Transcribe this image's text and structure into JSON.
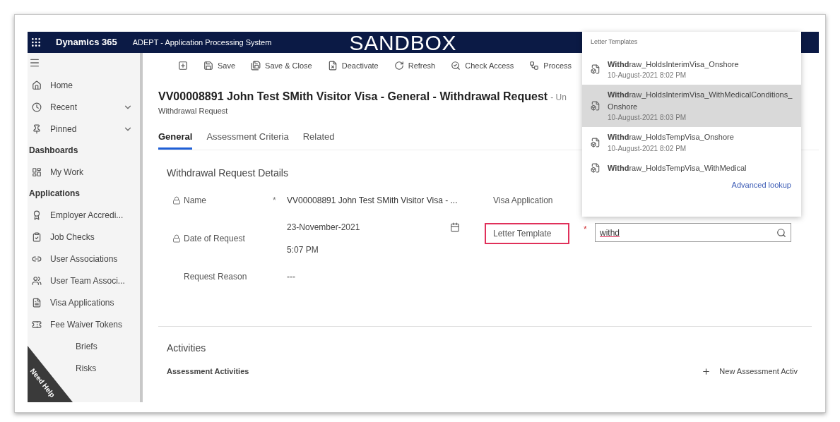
{
  "top_bar": {
    "app_name": "Dynamics 365",
    "system_name": "ADEPT - Application Processing System",
    "environment": "SANDBOX"
  },
  "sidebar": {
    "items": [
      {
        "label": "Home",
        "kind": "home"
      },
      {
        "label": "Recent",
        "kind": "recent"
      },
      {
        "label": "Pinned",
        "kind": "pinned"
      }
    ],
    "sections": [
      {
        "title": "Dashboards",
        "items": [
          {
            "label": "My Work",
            "kind": "dashboard"
          }
        ]
      },
      {
        "title": "Applications",
        "items": [
          {
            "label": "Employer Accredi...",
            "kind": "certificate"
          },
          {
            "label": "Job Checks",
            "kind": "check"
          },
          {
            "label": "User Associations",
            "kind": "link"
          },
          {
            "label": "User Team Associ...",
            "kind": "team"
          },
          {
            "label": "Visa Applications",
            "kind": "document"
          },
          {
            "label": "Fee Waiver Tokens",
            "kind": "token"
          },
          {
            "label": "Briefs",
            "kind": "obscured"
          },
          {
            "label": "Risks",
            "kind": "obscured"
          }
        ]
      }
    ],
    "help_badge": "Need Help"
  },
  "toolbar": [
    {
      "kind": "new"
    },
    {
      "kind": "save",
      "label": "Save"
    },
    {
      "kind": "save_close",
      "label": "Save & Close"
    },
    {
      "kind": "deactivate",
      "label": "Deactivate"
    },
    {
      "kind": "refresh",
      "label": "Refresh"
    },
    {
      "kind": "access",
      "label": "Check Access"
    },
    {
      "kind": "process",
      "label": "Process"
    }
  ],
  "header": {
    "title": "VV00008891 John Test SMith Visitor Visa - General - Withdrawal Request",
    "title_suffix": "- Un",
    "subtitle": "Withdrawal Request"
  },
  "tabs": [
    {
      "label": "General",
      "selected": true
    },
    {
      "label": "Assessment Criteria",
      "selected": false
    },
    {
      "label": "Related",
      "selected": false
    }
  ],
  "form": {
    "section_title": "Withdrawal Request Details",
    "required_mark": "*",
    "left_fields": [
      {
        "label": "Name",
        "kind": "text",
        "locked": true,
        "required": true,
        "value": "VV00008891 John Test SMith Visitor Visa - ..."
      },
      {
        "label": "Date of Request",
        "kind": "datetime",
        "locked": true,
        "required": false,
        "date": "23-November-2021",
        "time": "5:07 PM"
      },
      {
        "label": "Request Reason",
        "kind": "text",
        "locked": false,
        "required": false,
        "value": "---"
      }
    ],
    "right_fields": [
      {
        "label": "Visa Application",
        "kind": "covered",
        "highlighted": false,
        "required": false
      },
      {
        "label": "Letter Template",
        "kind": "lookup",
        "highlighted": true,
        "required": true,
        "value": "withd"
      }
    ]
  },
  "activities": {
    "title": "Activities",
    "subgrid_title": "Assessment Activities",
    "new_button": "New Assessment Activ"
  },
  "lookup_dropdown": {
    "title": "Letter Templates",
    "items": [
      {
        "name": "**Withd**raw_HoldsInterimVisa_Onshore",
        "date": "10-August-2021 8:02 PM",
        "selected": false
      },
      {
        "name": "**Withd**raw_HoldsInterimVisa_WithMedicalConditions_Onshore",
        "date": "10-August-2021 8:03 PM",
        "selected": true
      },
      {
        "name": "**Withd**raw_HoldsTempVisa_Onshore",
        "date": "10-August-2021 8:02 PM",
        "selected": false
      },
      {
        "name": "**Withd**raw_HoldsTempVisa_WithMedical",
        "selected": false
      }
    ],
    "advanced_link": "Advanced lookup"
  }
}
